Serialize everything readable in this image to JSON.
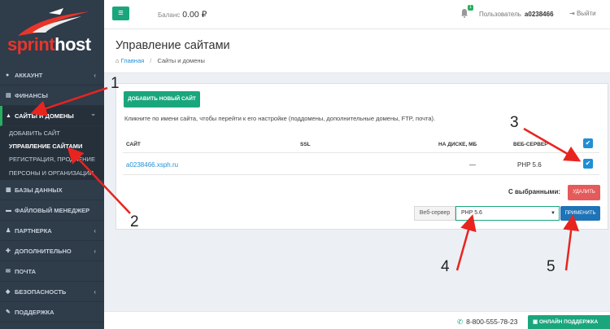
{
  "logo": {
    "part1": "sprint",
    "part2": "host"
  },
  "sidebar": {
    "items": [
      {
        "label": "Аккаунт",
        "icon": "user-icon",
        "chevron": "‹"
      },
      {
        "label": "Финансы",
        "icon": "wallet-icon",
        "chevron": ""
      },
      {
        "label": "Сайты и домены",
        "icon": "sites-icon",
        "chevron": "⌄"
      },
      {
        "label": "Базы данных",
        "icon": "database-icon",
        "chevron": ""
      },
      {
        "label": "Файловый менеджер",
        "icon": "folder-icon",
        "chevron": ""
      },
      {
        "label": "Партнерка",
        "icon": "partner-icon",
        "chevron": "‹"
      },
      {
        "label": "Дополнительно",
        "icon": "more-icon",
        "chevron": "‹"
      },
      {
        "label": "Почта",
        "icon": "mail-icon",
        "chevron": ""
      },
      {
        "label": "Безопасность",
        "icon": "shield-icon",
        "chevron": "‹"
      },
      {
        "label": "Поддержка",
        "icon": "support-icon",
        "chevron": ""
      }
    ],
    "submenu": [
      {
        "label": "Добавить сайт"
      },
      {
        "label": "Управление сайтами"
      },
      {
        "label": "Регистрация, продление"
      },
      {
        "label": "Персоны и организации"
      }
    ]
  },
  "header": {
    "balance_label": "Баланс",
    "balance_value": "0.00 ₽",
    "notif_count": "1",
    "user_label": "Пользователь",
    "username": "a0238466",
    "logout": "Выйти"
  },
  "page": {
    "title": "Управление сайтами",
    "breadcrumb_home": "Главная",
    "breadcrumb_current": "Сайты и домены"
  },
  "panel": {
    "add_button": "Добавить новый сайт",
    "hint": "Кликните по имени сайта, чтобы перейти к его настройке (поддомены, дополнительные домены, FTP, почта).",
    "columns": {
      "site": "Сайт",
      "ssl": "SSL",
      "disk": "На диске, МБ",
      "server": "Веб-сервер"
    },
    "rows": [
      {
        "site": "a0238466.xsph.ru",
        "ssl": "",
        "disk": "—",
        "server": "PHP 5.6"
      }
    ],
    "selected_label": "С выбранными:",
    "delete_button": "Удалить",
    "webserver_label": "Веб-сервер",
    "webserver_value": "PHP 5.6",
    "apply_button": "Применить"
  },
  "footer": {
    "phone": "8-800-555-78-23",
    "support_button": "Онлайн поддержка"
  },
  "annotations": {
    "n1": "1",
    "n2": "2",
    "n3": "3",
    "n4": "4",
    "n5": "5",
    "color": "#e8241f"
  },
  "colors": {
    "accent": "#1aa67d",
    "primary": "#1f73b7",
    "danger": "#e55a5a",
    "sidebar": "#2f3c4a"
  }
}
